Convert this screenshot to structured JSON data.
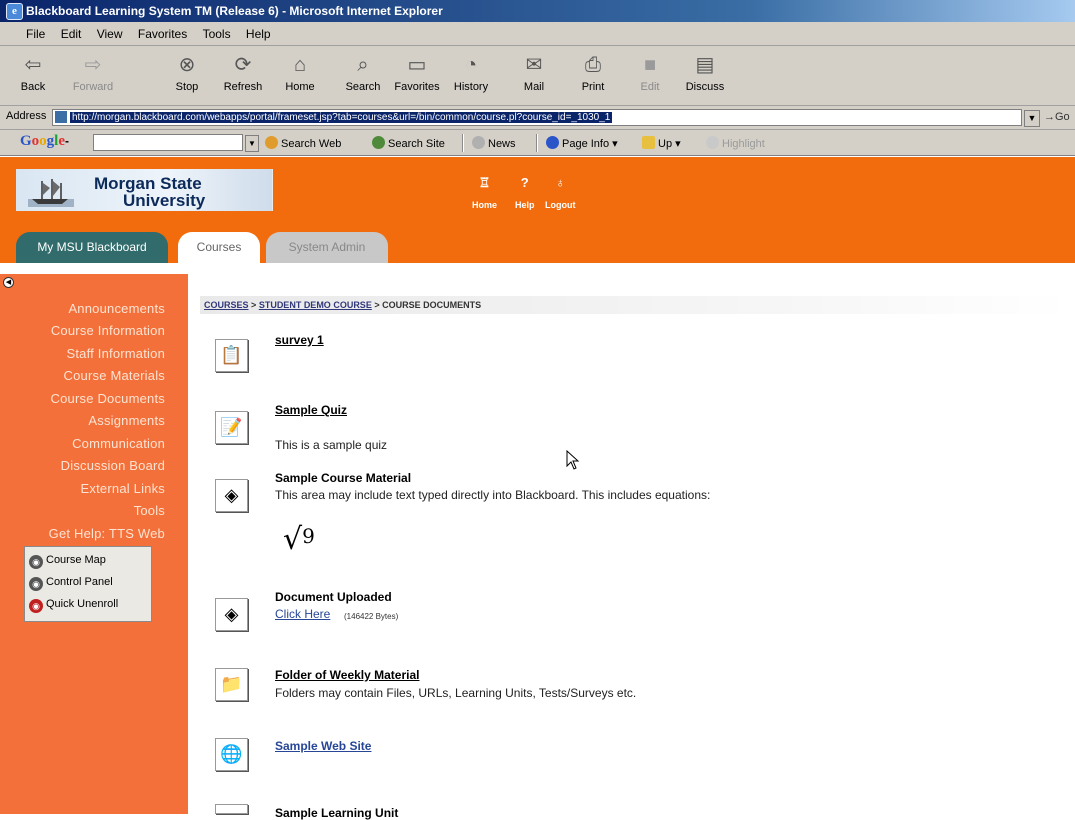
{
  "window": {
    "title": "Blackboard Learning System TM (Release 6) - Microsoft Internet Explorer",
    "menu": [
      "File",
      "Edit",
      "View",
      "Favorites",
      "Tools",
      "Help"
    ]
  },
  "toolbar": {
    "back": "Back",
    "forward": "Forward",
    "stop": "Stop",
    "refresh": "Refresh",
    "home": "Home",
    "search": "Search",
    "favorites": "Favorites",
    "history": "History",
    "mail": "Mail",
    "print": "Print",
    "edit": "Edit",
    "discuss": "Discuss"
  },
  "address": {
    "label": "Address",
    "url": "http://morgan.blackboard.com/webapps/portal/frameset.jsp?tab=courses&url=/bin/common/course.pl?course_id=_1030_1",
    "go": "Go"
  },
  "google": {
    "logo": "Google",
    "search_web": "Search Web",
    "search_site": "Search Site",
    "news": "News",
    "page_info": "Page Info",
    "up": "Up",
    "highlight": "Highlight"
  },
  "header": {
    "logo_line1": "Morgan State",
    "logo_line2": "University",
    "home": "Home",
    "help": "Help",
    "logout": "Logout",
    "tabs": [
      "My MSU Blackboard",
      "Courses",
      "System Admin"
    ]
  },
  "course_menu": {
    "items": [
      "Announcements",
      "Course Information",
      "Staff Information",
      "Course Materials",
      "Course Documents",
      "Assignments",
      "Communication",
      "Discussion Board",
      "External Links",
      "Tools",
      "Get Help: TTS Web"
    ],
    "tools": [
      "Course Map",
      "Control Panel",
      "Quick Unenroll"
    ]
  },
  "breadcrumb": {
    "courses": "COURSES",
    "course": "STUDENT DEMO COURSE",
    "current": "COURSE DOCUMENTS",
    "separator": ">"
  },
  "content": {
    "items": [
      {
        "title": "survey 1",
        "description": ""
      },
      {
        "title": "Sample Quiz",
        "description": "This is a sample quiz"
      },
      {
        "title": "Sample Course Material",
        "description": "This area may include text typed directly into Blackboard. This includes equations:"
      },
      {
        "title": "Document Uploaded",
        "link": "Click Here",
        "size": "(146422 Bytes)"
      },
      {
        "title": "Folder of Weekly Material",
        "description": "Folders may contain Files, URLs, Learning Units, Tests/Surveys etc."
      },
      {
        "title": "Sample Web Site",
        "description": ""
      },
      {
        "title": "Sample Learning Unit",
        "description": ""
      }
    ],
    "equation": "9"
  }
}
